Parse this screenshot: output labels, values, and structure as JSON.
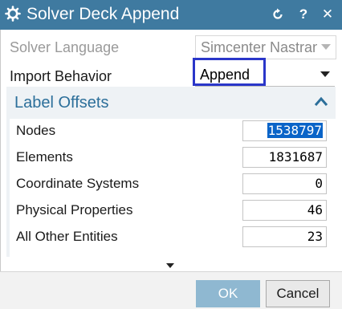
{
  "window": {
    "title": "Solver Deck Append",
    "icons": {
      "app": "gear-icon",
      "reset": "reset-icon",
      "help": "help-icon",
      "close": "close-icon"
    },
    "help_label": "?",
    "close_label": "✕",
    "reset_label": "↺"
  },
  "colors": {
    "titlebar": "#3f7aa0",
    "group_title": "#2c6f9a",
    "highlight": "#2a36c9",
    "selection": "#0a64c8",
    "ok_button": "#8fb8d1"
  },
  "form": {
    "solver_language": {
      "label": "Solver Language",
      "value": "Simcenter Nastran",
      "disabled": true
    },
    "import_behavior": {
      "label": "Import Behavior",
      "value": "Append"
    }
  },
  "label_offsets": {
    "title": "Label Offsets",
    "fields": [
      {
        "label": "Nodes",
        "value": "1538797",
        "selected": true
      },
      {
        "label": "Elements",
        "value": "1831687"
      },
      {
        "label": "Coordinate Systems",
        "value": "0"
      },
      {
        "label": "Physical Properties",
        "value": "46"
      },
      {
        "label": "All Other Entities",
        "value": "23"
      }
    ]
  },
  "buttons": {
    "ok": "OK",
    "cancel": "Cancel"
  }
}
